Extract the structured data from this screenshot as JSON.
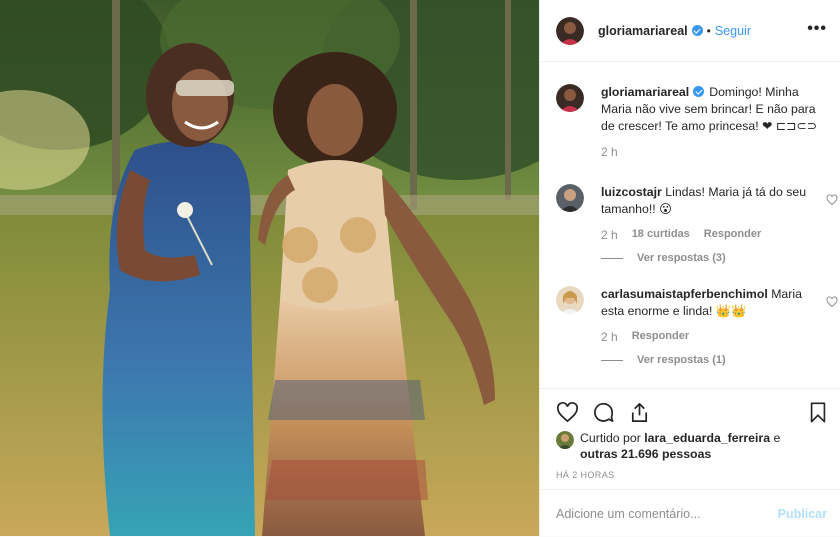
{
  "post": {
    "author": "gloriamariareal",
    "follow_label": "Seguir",
    "separator": "•",
    "more_label": "•••"
  },
  "caption": {
    "user": "gloriamariareal",
    "text": "Domingo! Minha Maria não vive sem brincar! E não para de crescer! Te amo princesa! ❤ ⊏⊐⊂⊃",
    "time": "2 h"
  },
  "comments": [
    {
      "user": "luizcostajr",
      "text": "Lindas! Maria já tá do seu tamanho!! 😮",
      "time": "2 h",
      "likes": "18 curtidas",
      "reply_label": "Responder",
      "view_replies": "Ver respostas (3)"
    },
    {
      "user": "carlasumaistapferbenchimol",
      "text": "Maria esta enorme e linda! 👑👑",
      "time": "2 h",
      "reply_label": "Responder",
      "view_replies": "Ver respostas (1)"
    }
  ],
  "liked_by": {
    "prefix": "Curtido por",
    "user": "lara_eduarda_ferreira",
    "middle": "e",
    "others": "outras 21.696 pessoas"
  },
  "timestamp_upper": "HÁ 2 HORAS",
  "add_comment": {
    "placeholder": "Adicione um comentário...",
    "publish_label": "Publicar"
  },
  "icons": {
    "like": "heart-icon",
    "comment": "comment-icon",
    "share": "share-icon",
    "save": "bookmark-icon",
    "verified": "verified-badge-icon"
  },
  "colors": {
    "link_blue": "#3897f0",
    "publish_disabled": "#b2dffc",
    "muted": "#8e8e8e",
    "text": "#262626"
  }
}
